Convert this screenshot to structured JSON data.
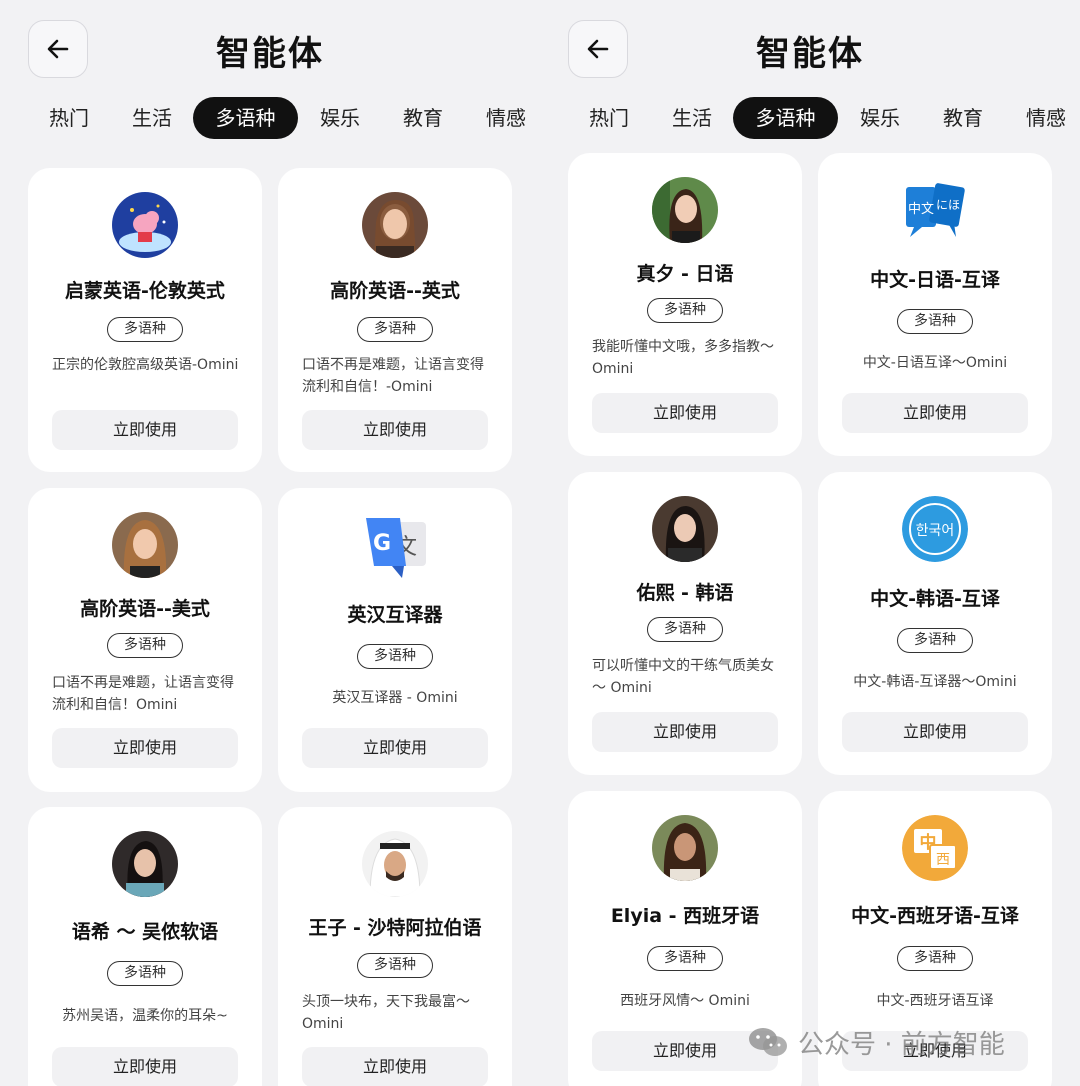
{
  "header": {
    "title": "智能体"
  },
  "tabs": [
    {
      "label": "热门"
    },
    {
      "label": "生活"
    },
    {
      "label": "多语种"
    },
    {
      "label": "娱乐"
    },
    {
      "label": "教育"
    },
    {
      "label": "情感"
    }
  ],
  "left_cards": [
    {
      "name": "启蒙英语-伦敦英式",
      "tag": "多语种",
      "desc": "正宗的伦敦腔高级英语-Omini",
      "action": "立即使用",
      "icon": "peppa-pig-avatar"
    },
    {
      "name": "高阶英语--英式",
      "tag": "多语种",
      "desc": "口语不再是难题，让语言变得流利和自信！-Omini",
      "action": "立即使用",
      "icon": "woman-portrait-avatar"
    },
    {
      "name": "高阶英语--美式",
      "tag": "多语种",
      "desc": "口语不再是难题，让语言变得流利和自信！Omini",
      "action": "立即使用",
      "icon": "woman-portrait-avatar"
    },
    {
      "name": "英汉互译器",
      "tag": "多语种",
      "desc": "英汉互译器 - Omini",
      "action": "立即使用",
      "icon": "google-translate-icon"
    },
    {
      "name": "语希 ～ 吴侬软语",
      "tag": "多语种",
      "desc": "苏州吴语，温柔你的耳朵~",
      "action": "立即使用",
      "icon": "woman-portrait-avatar"
    },
    {
      "name": "王子 - 沙特阿拉伯语",
      "tag": "多语种",
      "desc": "头顶一块布，天下我最富～Omini",
      "action": "立即使用",
      "icon": "man-portrait-avatar"
    }
  ],
  "right_cards": [
    {
      "name": "真夕 - 日语",
      "tag": "多语种",
      "desc": "我能听懂中文哦，多多指教～ Omini",
      "action": "立即使用",
      "icon": "woman-portrait-avatar"
    },
    {
      "name": "中文-日语-互译",
      "tag": "多语种",
      "desc": "中文-日语互译～Omini",
      "action": "立即使用",
      "icon": "chinese-japanese-translate-icon",
      "icon_text_a": "中文",
      "icon_text_b": "にほ"
    },
    {
      "name": "佑熙 - 韩语",
      "tag": "多语种",
      "desc": "可以听懂中文的干练气质美女～ Omini",
      "action": "立即使用",
      "icon": "woman-portrait-avatar"
    },
    {
      "name": "中文-韩语-互译",
      "tag": "多语种",
      "desc": "中文-韩语-互译器～Omini",
      "action": "立即使用",
      "icon": "korean-circle-icon",
      "icon_text": "한국어"
    },
    {
      "name": "Elyia - 西班牙语",
      "tag": "多语种",
      "desc": "西班牙风情～ Omini",
      "action": "立即使用",
      "icon": "woman-portrait-avatar"
    },
    {
      "name": "中文-西班牙语-互译",
      "tag": "多语种",
      "desc": "中文-西班牙语互译",
      "action": "立即使用",
      "icon": "chinese-spanish-translate-icon",
      "icon_text_a": "中",
      "icon_text_b": "西"
    }
  ],
  "watermark": {
    "text": "公众号 · 前方智能"
  },
  "colors": {
    "background": "#f2f2f4",
    "card": "#ffffff",
    "active_tab": "#111111",
    "button": "#f1f1f3"
  }
}
